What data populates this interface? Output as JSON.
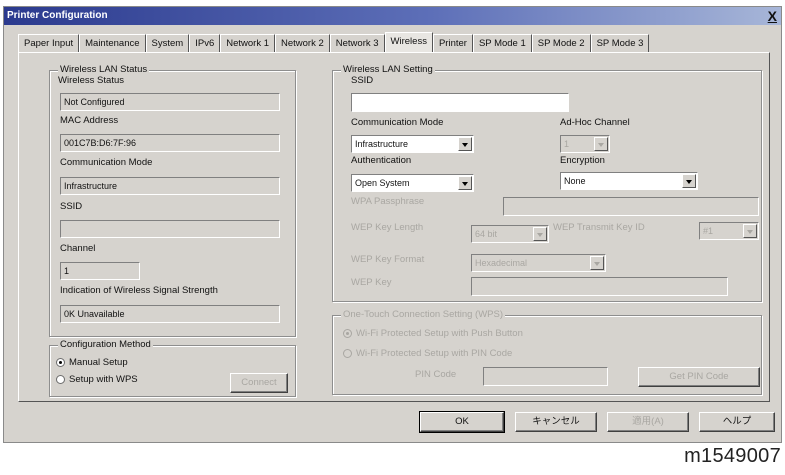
{
  "window": {
    "title": "Printer Configuration",
    "close_label": "X"
  },
  "tabs": [
    {
      "label": "Paper Input"
    },
    {
      "label": "Maintenance"
    },
    {
      "label": "System"
    },
    {
      "label": "IPv6"
    },
    {
      "label": "Network 1"
    },
    {
      "label": "Network 2"
    },
    {
      "label": "Network 3"
    },
    {
      "label": "Wireless"
    },
    {
      "label": "Printer"
    },
    {
      "label": "SP Mode 1"
    },
    {
      "label": "SP Mode 2"
    },
    {
      "label": "SP Mode 3"
    }
  ],
  "active_tab": "Wireless",
  "status": {
    "group_title": "Wireless LAN Status",
    "wireless_status_label": "Wireless Status",
    "wireless_status_value": "Not Configured",
    "mac_label": "MAC Address",
    "mac_value": "001C7B:D6:7F:96",
    "comm_mode_label": "Communication Mode",
    "comm_mode_value": "Infrastructure",
    "ssid_label": "SSID",
    "ssid_value": "",
    "channel_label": "Channel",
    "channel_value": "1",
    "signal_label": "Indication of Wireless Signal Strength",
    "signal_value": "0K Unavailable"
  },
  "config_method": {
    "group_title": "Configuration Method",
    "manual_label": "Manual Setup",
    "wps_label": "Setup with WPS",
    "connect_label": "Connect"
  },
  "setting": {
    "group_title": "Wireless LAN Setting",
    "ssid_label": "SSID",
    "ssid_value": "",
    "comm_mode_label": "Communication Mode",
    "comm_mode_value": "Infrastructure",
    "adhoc_label": "Ad-Hoc Channel",
    "adhoc_value": "1",
    "auth_label": "Authentication",
    "auth_value": "Open System",
    "encryption_label": "Encryption",
    "encryption_value": "None",
    "wpa_label": "WPA Passphrase",
    "wep_len_label": "WEP Key Length",
    "wep_len_value": "64 bit",
    "wep_tx_label": "WEP Transmit Key ID",
    "wep_tx_value": "#1",
    "wep_fmt_label": "WEP Key Format",
    "wep_fmt_value": "Hexadecimal",
    "wep_key_label": "WEP Key"
  },
  "wps": {
    "group_title": "One-Touch Connection Setting (WPS)",
    "push_label": "Wi-Fi Protected Setup with Push Button",
    "pin_label": "Wi-Fi Protected Setup with PIN Code",
    "pin_code_label": "PIN Code",
    "get_pin_label": "Get PIN Code"
  },
  "buttons": {
    "ok": "OK",
    "cancel": "キャンセル",
    "apply": "適用(A)",
    "help": "ヘルプ"
  },
  "caption": "m1549007"
}
